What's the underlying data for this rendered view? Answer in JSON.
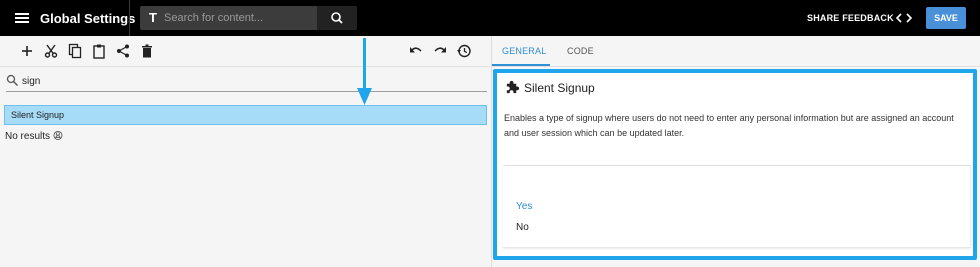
{
  "header": {
    "app_title": "Global Settings",
    "search_placeholder": "Search for content...",
    "share_feedback_label": "SHARE FEEDBACK",
    "save_label": "SAVE",
    "accent_color": "#4a90d9"
  },
  "toolbar": {
    "icons": [
      "add-icon",
      "cut-icon",
      "copy-icon",
      "paste-icon",
      "share-icon",
      "delete-icon",
      "undo-icon",
      "redo-icon",
      "history-icon"
    ]
  },
  "tree": {
    "filter_value": "sign",
    "results": [
      {
        "label": "Silent Signup"
      }
    ],
    "no_results_text": "No results 😩"
  },
  "tabs": [
    {
      "label": "GENERAL",
      "active": true
    },
    {
      "label": "CODE",
      "active": false
    }
  ],
  "detail": {
    "title": "Silent Signup",
    "description": "Enables a type of signup where users do not need to enter any personal information but are assigned an account and user session which can be updated later.",
    "options": [
      {
        "label": "Yes",
        "selected": true
      },
      {
        "label": "No",
        "selected": false
      }
    ],
    "highlight_color": "#1ea5ec"
  }
}
